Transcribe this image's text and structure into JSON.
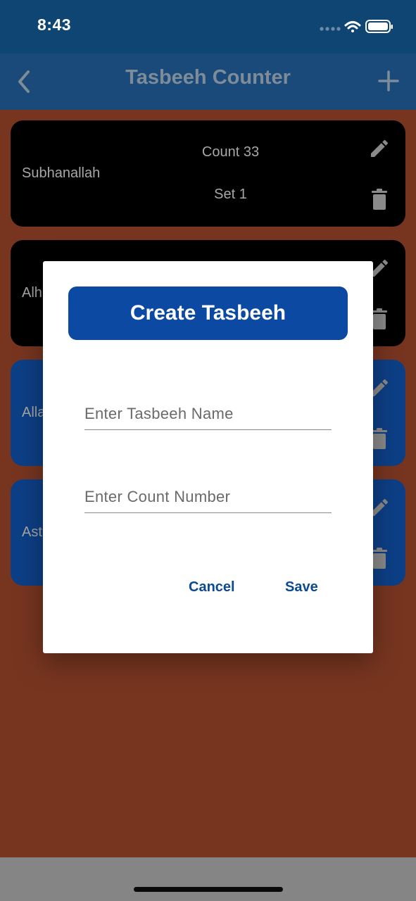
{
  "status_bar": {
    "time": "8:43"
  },
  "nav": {
    "title": "Tasbeeh Counter"
  },
  "cards": [
    {
      "name": "Subhanallah",
      "count": "Count 33",
      "set": "Set 1"
    },
    {
      "name": "Alh"
    },
    {
      "name": "Alla"
    },
    {
      "name": "Ast"
    }
  ],
  "dialog": {
    "title": "Create Tasbeeh",
    "name_placeholder": "Enter Tasbeeh Name",
    "count_placeholder": "Enter Count Number",
    "cancel_label": "Cancel",
    "save_label": "Save"
  },
  "colors": {
    "background": "#773520",
    "header": "#194a79",
    "card_black": "#000000",
    "card_blue": "#0d3f86",
    "accent": "#0c49a3"
  }
}
